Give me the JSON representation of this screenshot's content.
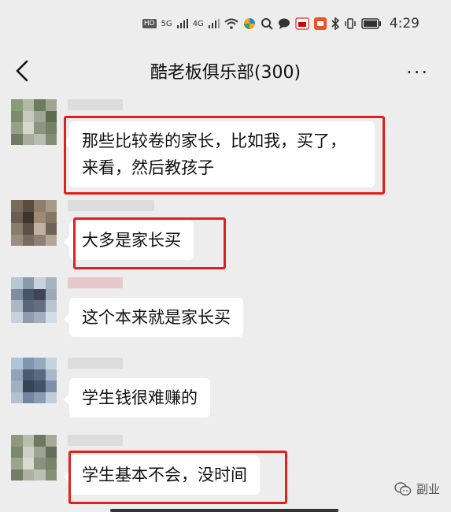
{
  "status": {
    "time": "4:29",
    "hd1": "HD",
    "hd2": "HD",
    "net1": "5G",
    "net2": "4G"
  },
  "header": {
    "title": "酷老板俱乐部(300)",
    "more_label": "···"
  },
  "messages": [
    {
      "text_line1": "那些比较卷的家长，比如我，买了，",
      "text_line2": "来看，然后教孩子",
      "highlighted": true
    },
    {
      "text": "大多是家长买",
      "highlighted": true
    },
    {
      "text": "这个本来就是家长买",
      "highlighted": false
    },
    {
      "text": "学生钱很难赚的",
      "highlighted": false
    },
    {
      "text": "学生基本不会，没时间",
      "highlighted": true
    }
  ],
  "watermark": {
    "text": "副业"
  },
  "colors": {
    "highlight": "#e0201f",
    "background": "#ededed",
    "bubble": "#ffffff"
  }
}
